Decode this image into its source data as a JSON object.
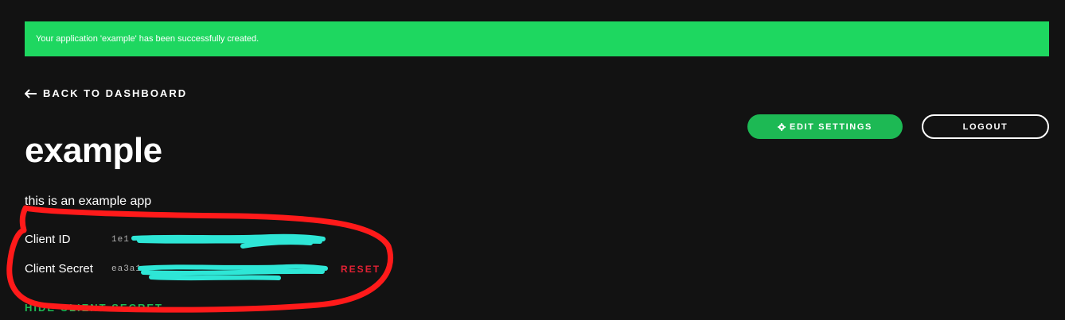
{
  "banner": {
    "message": "Your application 'example' has been successfully created."
  },
  "nav": {
    "back_label": "BACK TO DASHBOARD"
  },
  "app": {
    "name": "example",
    "description": "this is an example app"
  },
  "credentials": {
    "client_id_label": "Client ID",
    "client_id_value": "1e1",
    "client_secret_label": "Client Secret",
    "client_secret_value": "ea3a1",
    "reset_label": "RESET",
    "hide_secret_label": "HIDE CLIENT SECRET"
  },
  "actions": {
    "edit_settings_label": "EDIT SETTINGS",
    "logout_label": "LOGOUT"
  },
  "icons": {
    "back": "arrow-left-icon",
    "edit": "gear-icon"
  },
  "colors": {
    "background": "#121212",
    "banner": "#1ed760",
    "accent_green": "#1db954",
    "reset_red": "#e22134",
    "annotation_red": "#ff1a1a",
    "redaction_cyan": "#2ee6d6"
  }
}
